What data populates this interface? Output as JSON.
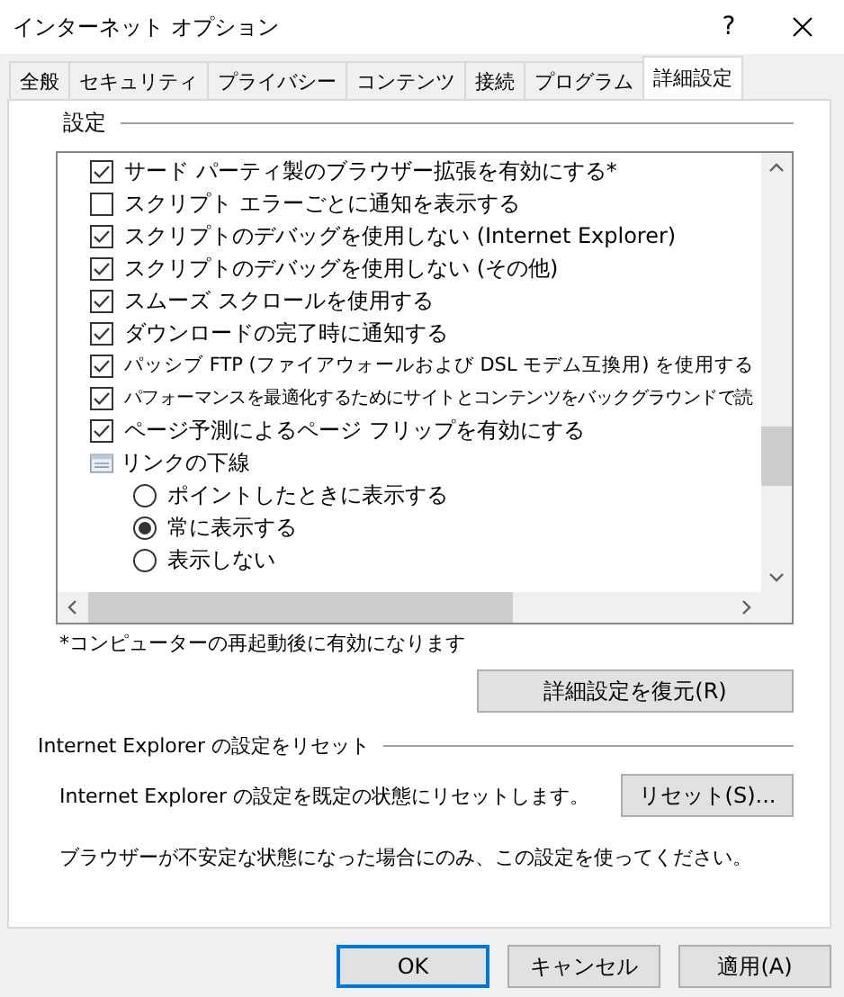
{
  "window": {
    "title": "インターネット オプション",
    "help": "?"
  },
  "tabs": [
    {
      "label": "全般",
      "selected": false
    },
    {
      "label": "セキュリティ",
      "selected": false
    },
    {
      "label": "プライバシー",
      "selected": false
    },
    {
      "label": "コンテンツ",
      "selected": false
    },
    {
      "label": "接続",
      "selected": false
    },
    {
      "label": "プログラム",
      "selected": false
    },
    {
      "label": "詳細設定",
      "selected": true
    }
  ],
  "settings": {
    "title": "設定",
    "items": [
      {
        "kind": "check",
        "label": "サード パーティ製のブラウザー拡張を有効にする*",
        "checked": true
      },
      {
        "kind": "check",
        "label": "スクリプト エラーごとに通知を表示する",
        "checked": false
      },
      {
        "kind": "check",
        "label": "スクリプトのデバッグを使用しない (Internet Explorer)",
        "checked": true
      },
      {
        "kind": "check",
        "label": "スクリプトのデバッグを使用しない (その他)",
        "checked": true
      },
      {
        "kind": "check",
        "label": "スムーズ スクロールを使用する",
        "checked": true
      },
      {
        "kind": "check",
        "label": "ダウンロードの完了時に通知する",
        "checked": true
      },
      {
        "kind": "check",
        "label": "パッシブ FTP (ファイアウォールおよび DSL モデム互換用) を使用する",
        "checked": true
      },
      {
        "kind": "check",
        "label": "パフォーマンスを最適化するためにサイトとコンテンツをバックグラウンドで読",
        "checked": true
      },
      {
        "kind": "check",
        "label": "ページ予測によるページ フリップを有効にする",
        "checked": true
      },
      {
        "kind": "group",
        "label": "リンクの下線",
        "children": [
          {
            "kind": "radio",
            "label": "ポイントしたときに表示する",
            "selected": false
          },
          {
            "kind": "radio",
            "label": "常に表示する",
            "selected": true
          },
          {
            "kind": "radio",
            "label": "表示しない",
            "selected": false
          }
        ]
      }
    ],
    "note": "*コンピューターの再起動後に有効になります",
    "restore_button": "詳細設定を復元(R)"
  },
  "reset": {
    "title": "Internet Explorer の設定をリセット",
    "description": "Internet Explorer の設定を既定の状態にリセットします。",
    "button": "リセット(S)...",
    "warning": "ブラウザーが不安定な状態になった場合にのみ、この設定を使ってください。"
  },
  "buttons": [
    {
      "label": "OK",
      "default": true
    },
    {
      "label": "キャンセル",
      "default": false
    },
    {
      "label": "適用(A)",
      "default": false
    }
  ]
}
